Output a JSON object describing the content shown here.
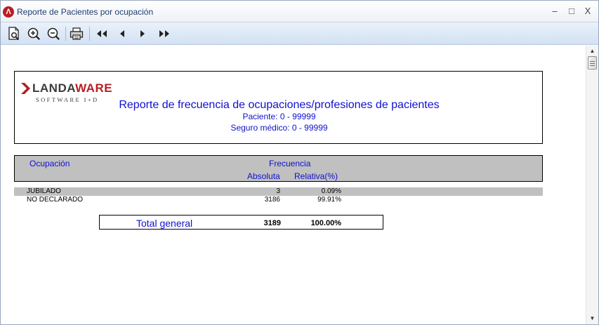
{
  "window": {
    "title": "Reporte de Pacientes por ocupación",
    "app_icon_glyph": "Λ",
    "controls": {
      "minimize": "–",
      "maximize": "□",
      "close": "X"
    }
  },
  "toolbar": {
    "buttons": [
      {
        "name": "page-preview-icon"
      },
      {
        "name": "zoom-in-icon"
      },
      {
        "name": "zoom-out-icon"
      },
      {
        "name": "print-icon"
      },
      {
        "name": "first-page-icon"
      },
      {
        "name": "previous-page-icon"
      },
      {
        "name": "next-page-icon"
      },
      {
        "name": "last-page-icon"
      }
    ]
  },
  "report": {
    "logo": {
      "name_dark": "LANDA",
      "name_accent": "WARE",
      "subtitle": "SOFTWARE I+D"
    },
    "title": "Reporte de frecuencia de ocupaciones/profesiones de pacientes",
    "filter_patient": "Paciente: 0 - 99999",
    "filter_insurance": "Seguro médico: 0 - 99999",
    "columns": {
      "occupation": "Ocupación",
      "frequency": "Frecuencia",
      "absolute": "Absoluta",
      "relative": "Relativa(%)"
    },
    "rows": [
      {
        "occupation": "JUBILADO",
        "absolute": "3",
        "relative": "0.09%"
      },
      {
        "occupation": "NO DECLARADO",
        "absolute": "3186",
        "relative": "99.91%"
      }
    ],
    "total": {
      "label": "Total general",
      "absolute": "3189",
      "relative": "100.00%"
    }
  },
  "scrollbar": {
    "up_arrow": "▲",
    "down_arrow": "▼"
  },
  "colors": {
    "report_blue": "#1010d0",
    "brand_red": "#b81d24",
    "header_gray": "#c0c0c0"
  }
}
